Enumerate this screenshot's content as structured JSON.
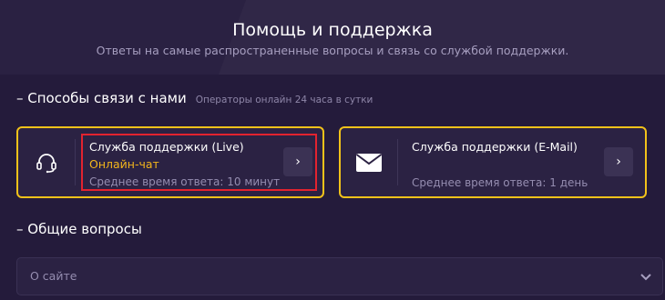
{
  "header": {
    "title": "Помощь и поддержка",
    "subtitle": "Ответы на самые распространенные вопросы и связь со службой поддержки."
  },
  "contact_section": {
    "toggle": "–",
    "title": "Способы связи с нами",
    "note": "Операторы онлайн 24 часа в сутки",
    "cards": [
      {
        "icon": "headset-icon",
        "title": "Служба поддержки (Live)",
        "accent": "Онлайн-чат",
        "meta": "Среднее время ответа: 10 минут",
        "arrow": "›"
      },
      {
        "icon": "mail-icon",
        "title": "Служба поддержки (E-Mail)",
        "meta": "Среднее время ответа: 1 день",
        "arrow": "›"
      }
    ]
  },
  "faq_section": {
    "toggle": "–",
    "title": "Общие вопросы",
    "select": {
      "selected": "О сайте",
      "icon": "chevron-down-icon"
    }
  },
  "colors": {
    "background": "#241b3b",
    "card_border": "#f2c21a",
    "accent": "#f2b51c",
    "highlight": "#e2232f"
  }
}
